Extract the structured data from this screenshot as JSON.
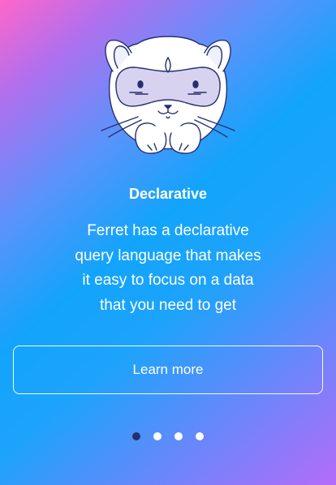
{
  "onboarding": {
    "title": "Declarative",
    "description_lines": [
      "Ferret has a declarative",
      "query language that makes",
      "it easy to focus on a data",
      "that you need to get"
    ],
    "button_label": "Learn more",
    "pagination": {
      "total": 4,
      "current": 1
    }
  },
  "mascot": {
    "icon": "ferret-mascot-icon"
  },
  "colors": {
    "gradient": [
      "#ff66c9",
      "#12a4fb",
      "#b46cf8"
    ],
    "text": "#ffffff",
    "dot_active": "#27306f",
    "dot_inactive": "#ffffff",
    "mascot_outline": "#27306f",
    "mascot_mask": "#d8d2f1"
  }
}
